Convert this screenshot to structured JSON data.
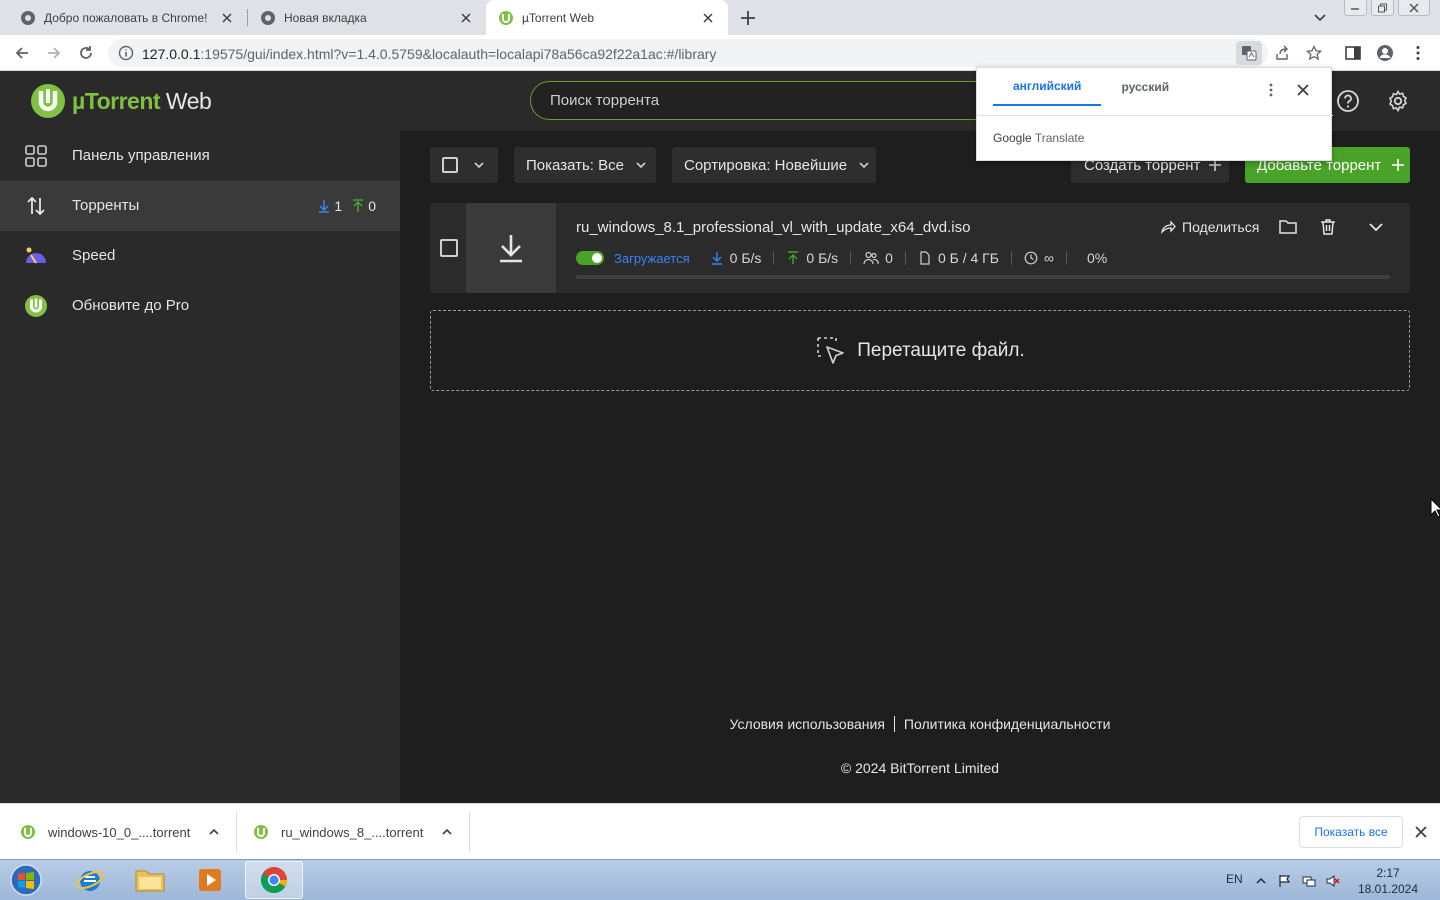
{
  "browser": {
    "tabs": [
      {
        "title": "Добро пожаловать в Chrome!",
        "active": false
      },
      {
        "title": "Новая вкладка",
        "active": false
      },
      {
        "title": "µTorrent Web",
        "active": true
      }
    ],
    "url_host": "127.0.0.1",
    "url_path": ":19575/gui/index.html?v=1.4.0.5759&localauth=localapi78a56ca92f22a1ac:#/library"
  },
  "translate_popup": {
    "tab_source": "английский",
    "tab_target": "русский",
    "brand_google": "Google",
    "brand_translate": "Translate"
  },
  "app": {
    "logo_mu": "µTorrent",
    "logo_web": " Web",
    "search_placeholder": "Поиск торрента",
    "sidebar": {
      "dashboard": "Панель управления",
      "torrents": "Торренты",
      "torrents_down_count": "1",
      "torrents_up_count": "0",
      "speed": "Speed",
      "upgrade": "Обновите до Pro"
    },
    "toolbar": {
      "show_label": "Показать:",
      "show_value": "Все",
      "sort_label": "Сортировка:",
      "sort_value": "Новейшие",
      "create": "Создать торрент",
      "add": "Добавьте торрент"
    },
    "torrent": {
      "name": "ru_windows_8.1_professional_vl_with_update_x64_dvd.iso",
      "status": "Загружается",
      "down_speed": "0 Б/s",
      "up_speed": "0 Б/s",
      "peers": "0",
      "size": "0 Б / 4 ГБ",
      "eta": "∞",
      "percent": "0%",
      "progress": 0,
      "share": "Поделиться"
    },
    "dropzone": "Перетащите файл.",
    "footer": {
      "terms": "Условия использования",
      "privacy": "Политика конфиденциальности",
      "copyright": "© 2024 BitTorrent Limited"
    }
  },
  "downloads": {
    "items": [
      "windows-10_0_....torrent",
      "ru_windows_8_....torrent"
    ],
    "show_all": "Показать все"
  },
  "taskbar": {
    "lang": "EN",
    "time": "2:17",
    "date": "18.01.2024"
  },
  "colors": {
    "accent_green": "#4aa329",
    "status_blue": "#3b82f6",
    "link_blue": "#1a73e8"
  }
}
